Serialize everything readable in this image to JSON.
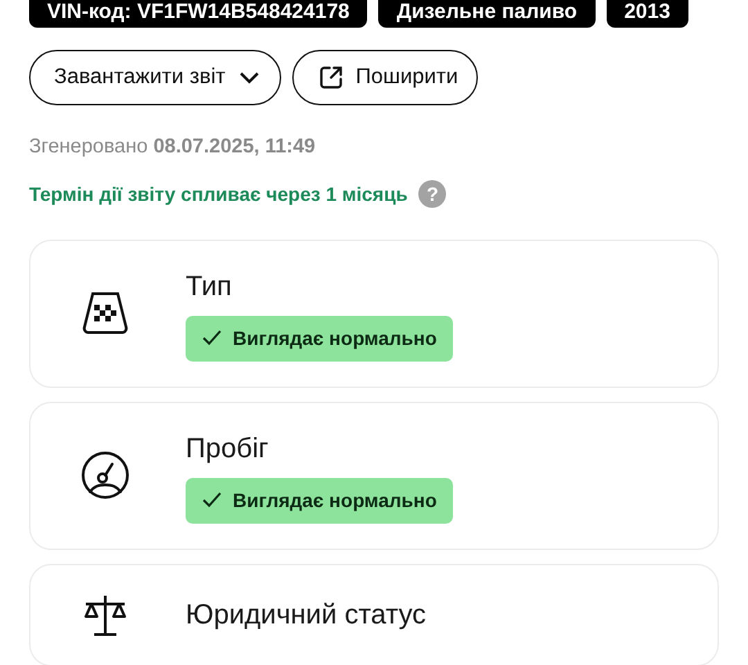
{
  "tags": [
    "VIN-код: VF1FW14B548424178",
    "Дизельне паливо",
    "2013"
  ],
  "actions": [
    {
      "label": "Завантажити звіт",
      "kind": "dropdown"
    },
    {
      "label": "Поширити",
      "kind": "share"
    }
  ],
  "generated": {
    "label": "Згенеровано",
    "value": "08.07.2025, 11:49"
  },
  "expiry": {
    "text": "Термін дії звіту спливає через 1 місяць",
    "help": "?"
  },
  "checks": [
    {
      "title": "Тип",
      "kind": "taxi",
      "status": "Виглядає нормально"
    },
    {
      "title": "Пробіг",
      "kind": "mileage",
      "status": "Виглядає нормально"
    },
    {
      "title": "Юридичний статус",
      "kind": "legal"
    }
  ]
}
